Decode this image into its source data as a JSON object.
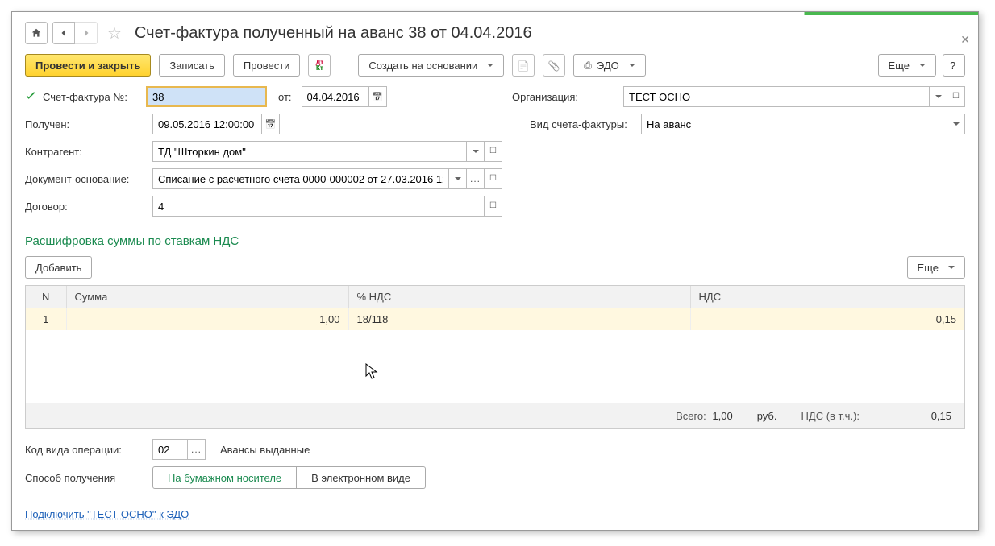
{
  "title": "Счет-фактура полученный на аванс 38 от 04.04.2016",
  "toolbar": {
    "post_close": "Провести и закрыть",
    "record": "Записать",
    "post": "Провести",
    "create_based": "Создать на основании",
    "edo": "ЭДО",
    "more": "Еще",
    "help": "?"
  },
  "form": {
    "invoice_no_label": "Счет-фактура №:",
    "invoice_no": "38",
    "from_label": "от:",
    "from_date": "04.04.2016",
    "org_label": "Организация:",
    "org": "ТЕСТ ОСНО",
    "received_label": "Получен:",
    "received": "09.05.2016 12:00:00",
    "invoice_type_label": "Вид счета-фактуры:",
    "invoice_type": "На аванс",
    "counterparty_label": "Контрагент:",
    "counterparty": "ТД \"Шторкин дом\"",
    "basis_label": "Документ-основание:",
    "basis": "Списание с расчетного счета 0000-000002 от 27.03.2016 12:",
    "contract_label": "Договор:",
    "contract": "4"
  },
  "section_title": "Расшифровка суммы по ставкам НДС",
  "table_toolbar": {
    "add": "Добавить",
    "more": "Еще"
  },
  "table": {
    "headers": {
      "n": "N",
      "sum": "Сумма",
      "vat_rate": "% НДС",
      "vat": "НДС"
    },
    "row": {
      "n": "1",
      "sum": "1,00",
      "vat_rate": "18/118",
      "vat": "0,15"
    }
  },
  "totals": {
    "total_label": "Всего:",
    "total": "1,00",
    "currency": "руб.",
    "vat_incl_label": "НДС (в т.ч.):",
    "vat_incl": "0,15"
  },
  "bottom": {
    "op_code_label": "Код вида операции:",
    "op_code": "02",
    "op_code_desc": "Авансы выданные",
    "receive_method_label": "Способ получения",
    "paper": "На бумажном носителе",
    "electronic": "В электронном виде"
  },
  "link": "Подключить \"ТЕСТ ОСНО\" к ЭДО"
}
